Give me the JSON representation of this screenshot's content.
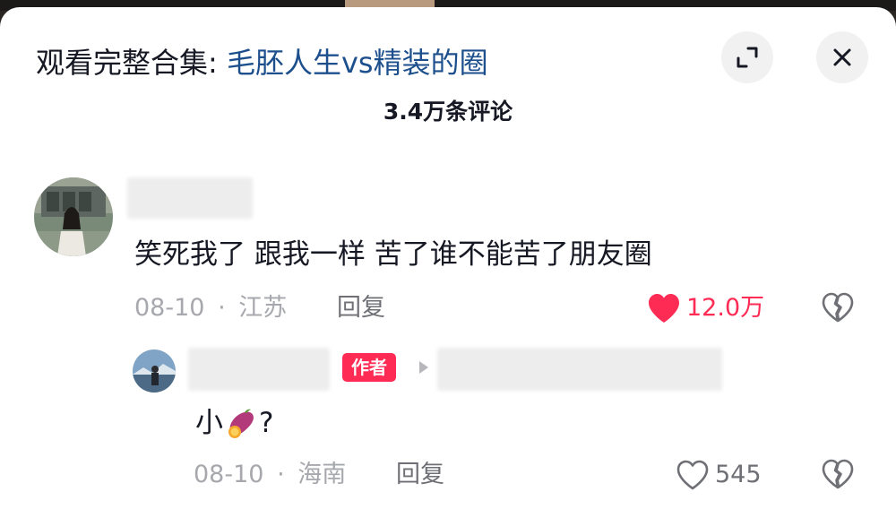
{
  "header": {
    "title_prefix": "观看完整合集: ",
    "title_link": "毛胚人生vs精装的圈",
    "expand_icon": "expand-icon",
    "close_icon": "close-icon"
  },
  "comments_count": "3.4万条评论",
  "comments": [
    {
      "text": "笑死我了 跟我一样 苦了谁不能苦了朋友圈",
      "date": "08-10",
      "separator": "·",
      "location": "江苏",
      "reply_label": "回复",
      "likes": "12.0万",
      "liked": true
    }
  ],
  "reply": {
    "author_badge": "作者",
    "text_before": "小",
    "emoji": "sweet-potato-emoji",
    "text_after": "?",
    "date": "08-10",
    "separator": "·",
    "location": "海南",
    "reply_label": "回复",
    "likes": "545",
    "liked": false
  },
  "colors": {
    "accent_red": "#fe2c55",
    "link_blue": "#1c4f8c",
    "text": "#161823",
    "meta_gray": "#a7a8ad"
  }
}
